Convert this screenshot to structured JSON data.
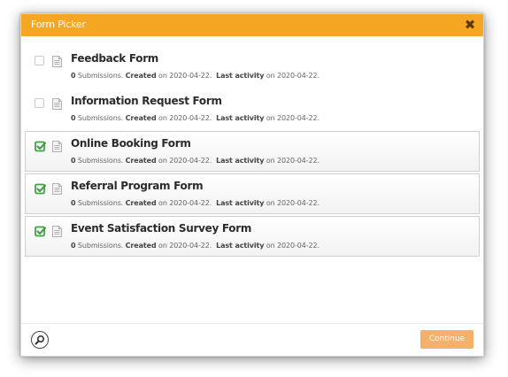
{
  "dialog": {
    "title": "Form Picker",
    "close_icon": "close-icon",
    "accent_color": "#f5a623"
  },
  "forms": [
    {
      "name": "Feedback Form",
      "checked": false,
      "submissions": "0",
      "submissions_label": "Submissions.",
      "created_label": "Created",
      "created_date": "on 2020-04-22.",
      "activity_label": "Last activity",
      "activity_date": "on 2020-04-22."
    },
    {
      "name": "Information Request Form",
      "checked": false,
      "submissions": "0",
      "submissions_label": "Submissions.",
      "created_label": "Created",
      "created_date": "on 2020-04-22.",
      "activity_label": "Last activity",
      "activity_date": "on 2020-04-22."
    },
    {
      "name": "Online Booking Form",
      "checked": true,
      "submissions": "0",
      "submissions_label": "Submissions.",
      "created_label": "Created",
      "created_date": "on 2020-04-22.",
      "activity_label": "Last activity",
      "activity_date": "on 2020-04-22."
    },
    {
      "name": "Referral Program Form",
      "checked": true,
      "submissions": "0",
      "submissions_label": "Submissions.",
      "created_label": "Created",
      "created_date": "on 2020-04-22.",
      "activity_label": "Last activity",
      "activity_date": "on 2020-04-22."
    },
    {
      "name": "Event Satisfaction Survey Form",
      "checked": true,
      "submissions": "0",
      "submissions_label": "Submissions.",
      "created_label": "Created",
      "created_date": "on 2020-04-22.",
      "activity_label": "Last activity",
      "activity_date": "on 2020-04-22."
    }
  ],
  "footer": {
    "search_icon": "search-icon",
    "continue_label": "Continue",
    "continue_color": "#f5b06a"
  },
  "colors": {
    "check_green": "#43a047"
  }
}
